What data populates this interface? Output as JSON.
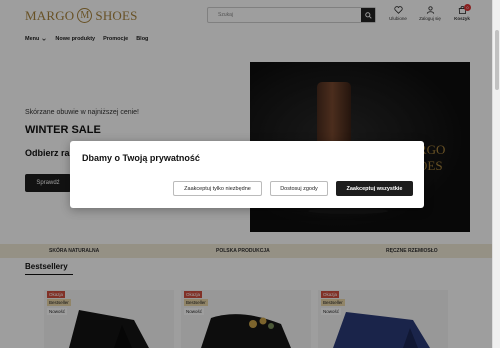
{
  "header": {
    "logo_left": "MARGO",
    "logo_mid": "M",
    "logo_right": "SHOES",
    "search_placeholder": "Szukaj",
    "wishlist_label": "Ulubione",
    "account_label": "Zaloguj się",
    "cart_label": "Koszyk",
    "cart_count": "0"
  },
  "nav": {
    "items": [
      "Menu",
      "Nowe produkty",
      "Promocje",
      "Blog"
    ]
  },
  "hero": {
    "subtitle": "Skórzane obuwie w najniższej cenie!",
    "title": "WINTER SALE",
    "offer": "Odbierz ra",
    "button": "Sprawdź",
    "image_logo_line1": "RGO",
    "image_logo_line2": "OES"
  },
  "features": [
    "SKÓRA NATURALNA",
    "POLSKA PRODUKCJA",
    "RĘCZNE RZEMIOSŁO"
  ],
  "bestsellers": {
    "title": "Bestsellery",
    "badges": {
      "sale": "Okazja",
      "best": "Bestseller",
      "new": "Nowość"
    }
  },
  "cookie": {
    "title": "Dbamy o Twoją prywatność",
    "btn_necessary": "Zaakceptuj tylko niezbędne",
    "btn_adjust": "Dostosuj zgody",
    "btn_accept_all": "Zaakceptuj wszystkie"
  },
  "colors": {
    "brand_gold": "#a8843c",
    "features_bg": "#f1ead7",
    "sale_badge": "#d0503f",
    "cart_badge": "#d33333"
  }
}
